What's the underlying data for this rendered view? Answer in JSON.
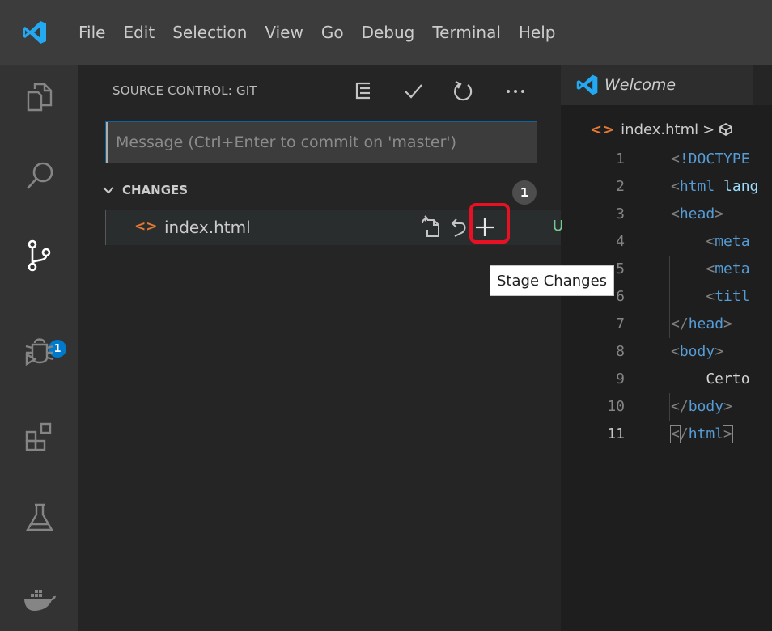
{
  "menu": [
    "File",
    "Edit",
    "Selection",
    "View",
    "Go",
    "Debug",
    "Terminal",
    "Help"
  ],
  "activity_bar": {
    "icons": [
      "explorer-icon",
      "search-icon",
      "source-control-icon",
      "debug-icon",
      "extensions-icon",
      "test-icon",
      "docker-icon"
    ],
    "source_control_badge": "1"
  },
  "source_control": {
    "title": "SOURCE CONTROL: GIT",
    "commit_placeholder": "Message (Ctrl+Enter to commit on 'master')",
    "changes_label": "CHANGES",
    "changes_count": "1",
    "files": [
      {
        "name": "index.html",
        "status": "U"
      }
    ],
    "tooltip": "Stage Changes"
  },
  "editor": {
    "tab_label": "Welcome",
    "breadcrumb_file": "index.html",
    "breadcrumb_sep": ">",
    "line_numbers": [
      "1",
      "2",
      "3",
      "4",
      "5",
      "6",
      "7",
      "8",
      "9",
      "10",
      "11"
    ]
  },
  "colors": {
    "accent": "#007acc",
    "highlight": "#e81123",
    "untracked": "#73c991",
    "file_icon": "#e37933"
  }
}
